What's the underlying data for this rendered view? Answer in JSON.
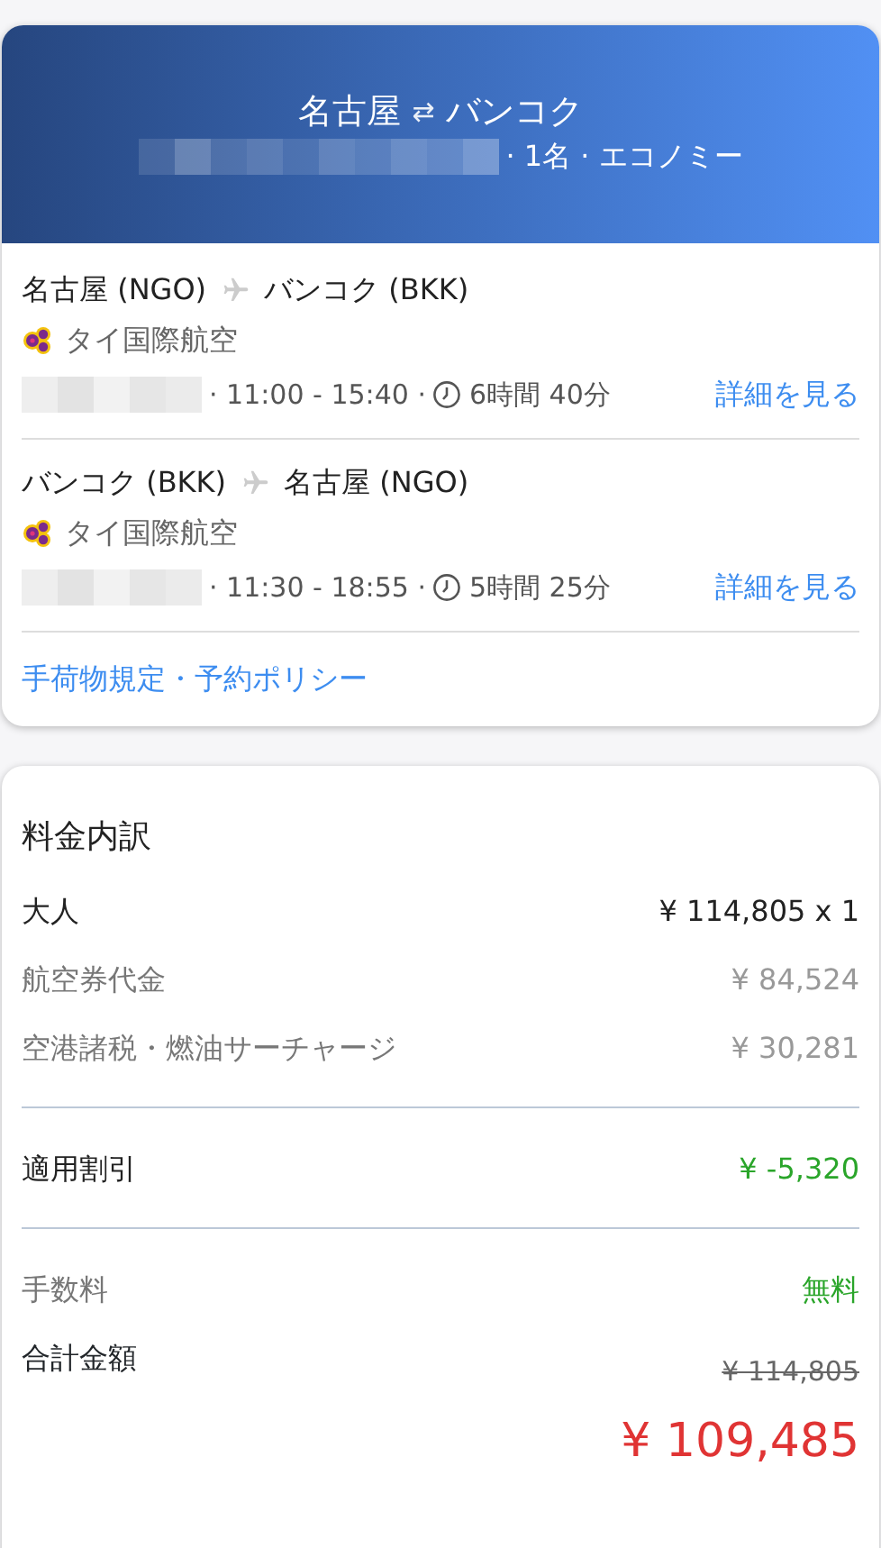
{
  "header": {
    "from": "名古屋",
    "swap_symbol": "⇄",
    "to": "バンコク",
    "trip_info": "· 1名 · エコノミー"
  },
  "flights": [
    {
      "from": "名古屋 (NGO)",
      "to": "バンコク (BKK)",
      "airline": "タイ国際航空",
      "times": "· 11:00 - 15:40 ·",
      "duration": "6時間 40分",
      "details_link": "詳細を見る"
    },
    {
      "from": "バンコク (BKK)",
      "to": "名古屋 (NGO)",
      "airline": "タイ国際航空",
      "times": "· 11:30 - 18:55 ·",
      "duration": "5時間 25分",
      "details_link": "詳細を見る"
    }
  ],
  "policy_link": "手荷物規定・予約ポリシー",
  "breakdown": {
    "title": "料金内訳",
    "sections": [
      {
        "rows": [
          {
            "label": "大人",
            "value": "¥ 114,805 x 1",
            "kind": "main"
          },
          {
            "label": "航空券代金",
            "value": "¥ 84,524",
            "kind": "sub"
          },
          {
            "label": "空港諸税・燃油サーチャージ",
            "value": "¥ 30,281",
            "kind": "sub"
          }
        ]
      },
      {
        "rows": [
          {
            "label": "適用割引",
            "value": "¥ -5,320",
            "kind": "discount"
          }
        ]
      },
      {
        "rows": [
          {
            "label": "手数料",
            "value": "無料",
            "kind": "fee"
          }
        ]
      }
    ],
    "total": {
      "label": "合計金額",
      "original": "¥ 114,805",
      "amount": "¥ 109,485"
    }
  }
}
